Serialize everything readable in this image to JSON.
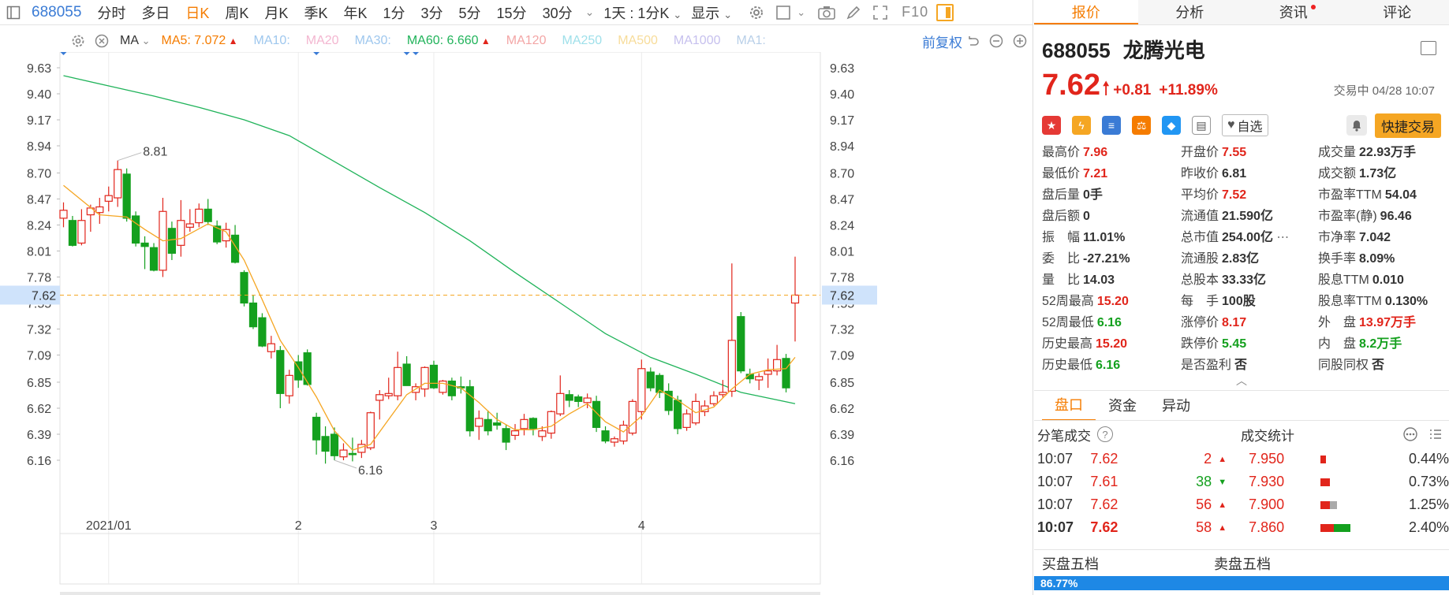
{
  "toolbar": {
    "code": "688055",
    "periods": [
      "分时",
      "多日",
      "日K",
      "周K",
      "月K",
      "季K",
      "年K",
      "1分",
      "3分",
      "5分",
      "15分",
      "30分"
    ],
    "active_period": "日K",
    "interval_label": "1天 : 1分K",
    "display_label": "显示",
    "f10_label": "F10"
  },
  "ma_row": {
    "ma_label": "MA",
    "items": [
      {
        "label": "MA5:",
        "value": "7.072",
        "color": "#f57c00",
        "arrow": "▲"
      },
      {
        "label": "MA10:",
        "value": "",
        "color": "#9ec7ee",
        "arrow": ""
      },
      {
        "label": "MA20",
        "value": "",
        "color": "#f3b6d0",
        "arrow": ""
      },
      {
        "label": "MA30:",
        "value": "",
        "color": "#9ec7ee",
        "arrow": ""
      },
      {
        "label": "MA60:",
        "value": "6.660",
        "color": "#20b35a",
        "arrow": "▲"
      },
      {
        "label": "MA120",
        "value": "",
        "color": "#f3a6a6",
        "arrow": ""
      },
      {
        "label": "MA250",
        "value": "",
        "color": "#9fe0ea",
        "arrow": ""
      },
      {
        "label": "MA500",
        "value": "",
        "color": "#f7dc9a",
        "arrow": ""
      },
      {
        "label": "MA1000",
        "value": "",
        "color": "#c6c0ee",
        "arrow": ""
      },
      {
        "label": "MA1:",
        "value": "",
        "color": "#b8cfe8",
        "arrow": ""
      }
    ],
    "adjust_label": "前复权"
  },
  "chart_data": {
    "type": "candlestick",
    "y_ticks": [
      "9.63",
      "9.40",
      "9.17",
      "8.94",
      "8.70",
      "8.47",
      "8.24",
      "8.01",
      "7.78",
      "7.55",
      "7.32",
      "7.09",
      "6.85",
      "6.62",
      "6.39",
      "6.16"
    ],
    "ylim": [
      6.0,
      9.7
    ],
    "x_labels": [
      {
        "index": 5,
        "label": "2021/01"
      },
      {
        "index": 26,
        "label": "2"
      },
      {
        "index": 41,
        "label": "3"
      },
      {
        "index": 64,
        "label": "4"
      }
    ],
    "current_price_label": "7.62",
    "current_price": 7.62,
    "high_label": {
      "index": 6,
      "value": 8.81,
      "text": "8.81"
    },
    "low_label": {
      "index": 30,
      "value": 6.16,
      "text": "6.16"
    },
    "event_markers": [
      0,
      28,
      38,
      39
    ],
    "candles": [
      {
        "o": 8.3,
        "h": 8.44,
        "l": 8.22,
        "c": 8.37
      },
      {
        "o": 8.28,
        "h": 8.32,
        "l": 8.05,
        "c": 8.06
      },
      {
        "o": 8.08,
        "h": 8.38,
        "l": 8.06,
        "c": 8.28
      },
      {
        "o": 8.33,
        "h": 8.42,
        "l": 8.18,
        "c": 8.39
      },
      {
        "o": 8.35,
        "h": 8.48,
        "l": 8.25,
        "c": 8.4
      },
      {
        "o": 8.45,
        "h": 8.58,
        "l": 8.36,
        "c": 8.5
      },
      {
        "o": 8.48,
        "h": 8.81,
        "l": 8.4,
        "c": 8.73
      },
      {
        "o": 8.69,
        "h": 8.74,
        "l": 8.27,
        "c": 8.3
      },
      {
        "o": 8.32,
        "h": 8.36,
        "l": 8.05,
        "c": 8.08
      },
      {
        "o": 8.08,
        "h": 8.14,
        "l": 7.85,
        "c": 8.05
      },
      {
        "o": 8.04,
        "h": 8.08,
        "l": 7.83,
        "c": 7.84
      },
      {
        "o": 7.84,
        "h": 8.48,
        "l": 7.78,
        "c": 8.36
      },
      {
        "o": 8.21,
        "h": 8.27,
        "l": 7.93,
        "c": 7.99
      },
      {
        "o": 8.06,
        "h": 8.46,
        "l": 7.96,
        "c": 8.28
      },
      {
        "o": 8.22,
        "h": 8.38,
        "l": 8.18,
        "c": 8.25
      },
      {
        "o": 8.26,
        "h": 8.43,
        "l": 8.22,
        "c": 8.38
      },
      {
        "o": 8.38,
        "h": 8.47,
        "l": 8.24,
        "c": 8.27
      },
      {
        "o": 8.23,
        "h": 8.28,
        "l": 8.07,
        "c": 8.09
      },
      {
        "o": 8.1,
        "h": 8.26,
        "l": 8.04,
        "c": 8.2
      },
      {
        "o": 8.15,
        "h": 8.24,
        "l": 7.9,
        "c": 7.91
      },
      {
        "o": 7.82,
        "h": 7.84,
        "l": 7.52,
        "c": 7.55
      },
      {
        "o": 7.55,
        "h": 7.62,
        "l": 7.32,
        "c": 7.34
      },
      {
        "o": 7.42,
        "h": 7.46,
        "l": 7.16,
        "c": 7.17
      },
      {
        "o": 7.12,
        "h": 7.26,
        "l": 7.06,
        "c": 7.19
      },
      {
        "o": 7.13,
        "h": 7.17,
        "l": 6.62,
        "c": 6.75
      },
      {
        "o": 6.73,
        "h": 6.96,
        "l": 6.66,
        "c": 6.91
      },
      {
        "o": 7.03,
        "h": 7.09,
        "l": 6.8,
        "c": 6.87
      },
      {
        "o": 7.11,
        "h": 7.14,
        "l": 6.82,
        "c": 6.83
      },
      {
        "o": 6.54,
        "h": 6.58,
        "l": 6.21,
        "c": 6.34
      },
      {
        "o": 6.37,
        "h": 6.46,
        "l": 6.13,
        "c": 6.24
      },
      {
        "o": 6.39,
        "h": 6.45,
        "l": 6.16,
        "c": 6.2
      },
      {
        "o": 6.19,
        "h": 6.31,
        "l": 6.16,
        "c": 6.25
      },
      {
        "o": 6.22,
        "h": 6.36,
        "l": 6.15,
        "c": 6.21
      },
      {
        "o": 6.23,
        "h": 6.34,
        "l": 6.18,
        "c": 6.3
      },
      {
        "o": 6.27,
        "h": 6.59,
        "l": 6.25,
        "c": 6.58
      },
      {
        "o": 6.69,
        "h": 6.78,
        "l": 6.52,
        "c": 6.74
      },
      {
        "o": 6.73,
        "h": 6.89,
        "l": 6.7,
        "c": 6.75
      },
      {
        "o": 6.73,
        "h": 7.12,
        "l": 6.69,
        "c": 6.98
      },
      {
        "o": 7.01,
        "h": 7.08,
        "l": 6.82,
        "c": 6.82
      },
      {
        "o": 6.76,
        "h": 6.84,
        "l": 6.69,
        "c": 6.81
      },
      {
        "o": 6.79,
        "h": 6.99,
        "l": 6.72,
        "c": 6.98
      },
      {
        "o": 7.0,
        "h": 7.04,
        "l": 6.79,
        "c": 6.8
      },
      {
        "o": 6.76,
        "h": 6.87,
        "l": 6.74,
        "c": 6.86
      },
      {
        "o": 6.86,
        "h": 6.89,
        "l": 6.69,
        "c": 6.73
      },
      {
        "o": 6.81,
        "h": 6.9,
        "l": 6.75,
        "c": 6.8
      },
      {
        "o": 6.81,
        "h": 6.87,
        "l": 6.37,
        "c": 6.42
      },
      {
        "o": 6.46,
        "h": 6.6,
        "l": 6.34,
        "c": 6.53
      },
      {
        "o": 6.52,
        "h": 6.6,
        "l": 6.38,
        "c": 6.42
      },
      {
        "o": 6.49,
        "h": 6.58,
        "l": 6.43,
        "c": 6.47
      },
      {
        "o": 6.44,
        "h": 6.47,
        "l": 6.25,
        "c": 6.32
      },
      {
        "o": 6.38,
        "h": 6.48,
        "l": 6.34,
        "c": 6.42
      },
      {
        "o": 6.44,
        "h": 6.57,
        "l": 6.38,
        "c": 6.52
      },
      {
        "o": 6.53,
        "h": 6.54,
        "l": 6.38,
        "c": 6.44
      },
      {
        "o": 6.37,
        "h": 6.46,
        "l": 6.33,
        "c": 6.42
      },
      {
        "o": 6.4,
        "h": 6.6,
        "l": 6.35,
        "c": 6.59
      },
      {
        "o": 6.57,
        "h": 6.91,
        "l": 6.55,
        "c": 6.75
      },
      {
        "o": 6.74,
        "h": 6.78,
        "l": 6.63,
        "c": 6.69
      },
      {
        "o": 6.72,
        "h": 6.74,
        "l": 6.63,
        "c": 6.68
      },
      {
        "o": 6.67,
        "h": 6.75,
        "l": 6.62,
        "c": 6.71
      },
      {
        "o": 6.68,
        "h": 6.73,
        "l": 6.41,
        "c": 6.45
      },
      {
        "o": 6.42,
        "h": 6.46,
        "l": 6.31,
        "c": 6.33
      },
      {
        "o": 6.32,
        "h": 6.37,
        "l": 6.28,
        "c": 6.35
      },
      {
        "o": 6.33,
        "h": 6.51,
        "l": 6.3,
        "c": 6.47
      },
      {
        "o": 6.4,
        "h": 6.7,
        "l": 6.38,
        "c": 6.68
      },
      {
        "o": 6.59,
        "h": 7.05,
        "l": 6.52,
        "c": 6.97
      },
      {
        "o": 6.94,
        "h": 6.98,
        "l": 6.77,
        "c": 6.8
      },
      {
        "o": 6.91,
        "h": 6.93,
        "l": 6.71,
        "c": 6.76
      },
      {
        "o": 6.77,
        "h": 6.84,
        "l": 6.56,
        "c": 6.6
      },
      {
        "o": 6.69,
        "h": 6.73,
        "l": 6.39,
        "c": 6.44
      },
      {
        "o": 6.45,
        "h": 6.61,
        "l": 6.42,
        "c": 6.57
      },
      {
        "o": 6.49,
        "h": 6.75,
        "l": 6.47,
        "c": 6.68
      },
      {
        "o": 6.59,
        "h": 6.69,
        "l": 6.55,
        "c": 6.64
      },
      {
        "o": 6.66,
        "h": 6.77,
        "l": 6.64,
        "c": 6.73
      },
      {
        "o": 6.74,
        "h": 6.87,
        "l": 6.71,
        "c": 6.76
      },
      {
        "o": 6.77,
        "h": 7.9,
        "l": 6.72,
        "c": 7.22
      },
      {
        "o": 7.43,
        "h": 7.47,
        "l": 6.93,
        "c": 6.95
      },
      {
        "o": 6.92,
        "h": 6.97,
        "l": 6.84,
        "c": 6.88
      },
      {
        "o": 6.87,
        "h": 6.93,
        "l": 6.78,
        "c": 6.9
      },
      {
        "o": 6.92,
        "h": 7.06,
        "l": 6.8,
        "c": 6.95
      },
      {
        "o": 6.95,
        "h": 7.18,
        "l": 6.91,
        "c": 7.05
      },
      {
        "o": 7.06,
        "h": 7.1,
        "l": 6.76,
        "c": 6.8
      },
      {
        "o": 7.55,
        "h": 7.96,
        "l": 7.21,
        "c": 7.62
      }
    ],
    "ma5": [
      [
        0,
        8.59
      ],
      [
        4,
        8.33
      ],
      [
        7,
        8.31
      ],
      [
        9,
        8.2
      ],
      [
        11,
        8.1
      ],
      [
        13,
        8.12
      ],
      [
        16,
        8.25
      ],
      [
        18,
        8.18
      ],
      [
        20,
        7.93
      ],
      [
        22,
        7.58
      ],
      [
        24,
        7.22
      ],
      [
        26,
        6.98
      ],
      [
        28,
        6.72
      ],
      [
        30,
        6.42
      ],
      [
        32,
        6.25
      ],
      [
        34,
        6.3
      ],
      [
        36,
        6.52
      ],
      [
        38,
        6.74
      ],
      [
        40,
        6.84
      ],
      [
        42,
        6.84
      ],
      [
        44,
        6.8
      ],
      [
        46,
        6.67
      ],
      [
        48,
        6.52
      ],
      [
        50,
        6.43
      ],
      [
        52,
        6.43
      ],
      [
        54,
        6.46
      ],
      [
        56,
        6.57
      ],
      [
        58,
        6.66
      ],
      [
        60,
        6.5
      ],
      [
        62,
        6.41
      ],
      [
        64,
        6.55
      ],
      [
        66,
        6.78
      ],
      [
        68,
        6.69
      ],
      [
        70,
        6.58
      ],
      [
        72,
        6.63
      ],
      [
        74,
        6.79
      ],
      [
        76,
        6.92
      ],
      [
        78,
        6.96
      ],
      [
        80,
        6.97
      ],
      [
        81,
        7.07
      ]
    ],
    "ma60": [
      [
        0,
        9.56
      ],
      [
        5,
        9.47
      ],
      [
        10,
        9.38
      ],
      [
        15,
        9.28
      ],
      [
        20,
        9.17
      ],
      [
        25,
        9.03
      ],
      [
        30,
        8.8
      ],
      [
        35,
        8.57
      ],
      [
        40,
        8.35
      ],
      [
        45,
        8.1
      ],
      [
        50,
        7.82
      ],
      [
        55,
        7.55
      ],
      [
        60,
        7.28
      ],
      [
        65,
        7.07
      ],
      [
        70,
        6.92
      ],
      [
        75,
        6.76
      ],
      [
        81,
        6.66
      ]
    ]
  },
  "panel": {
    "tabs": [
      "报价",
      "分析",
      "资讯",
      "评论"
    ],
    "active_tab": "报价",
    "code": "688055",
    "name": "龙腾光电",
    "price": "7.62",
    "change": "+0.81",
    "change_pct": "+11.89%",
    "status": "交易中 04/28 10:07",
    "watch_label": "自选",
    "quick_trade_label": "快捷交易",
    "quotes": [
      {
        "label": "最高价",
        "value": "7.96",
        "cls": "red"
      },
      {
        "label": "开盘价",
        "value": "7.55",
        "cls": "red"
      },
      {
        "label": "成交量",
        "value": "22.93万手",
        "cls": ""
      },
      {
        "label": "最低价",
        "value": "7.21",
        "cls": "red"
      },
      {
        "label": "昨收价",
        "value": "6.81",
        "cls": ""
      },
      {
        "label": "成交额",
        "value": "1.73亿",
        "cls": ""
      },
      {
        "label": "盘后量",
        "value": "0手",
        "cls": ""
      },
      {
        "label": "平均价",
        "value": "7.52",
        "cls": "red"
      },
      {
        "label": "市盈率TTM",
        "value": "54.04",
        "cls": ""
      },
      {
        "label": "盘后额",
        "value": "0",
        "cls": ""
      },
      {
        "label": "流通值",
        "value": "21.590亿",
        "cls": ""
      },
      {
        "label": "市盈率(静)",
        "value": "96.46",
        "cls": ""
      },
      {
        "label": "振　幅",
        "value": "11.01%",
        "cls": ""
      },
      {
        "label": "总市值",
        "value": "254.00亿",
        "cls": ""
      },
      {
        "label": "市净率",
        "value": "7.042",
        "cls": ""
      },
      {
        "label": "委　比",
        "value": "-27.21%",
        "cls": ""
      },
      {
        "label": "流通股",
        "value": "2.83亿",
        "cls": ""
      },
      {
        "label": "换手率",
        "value": "8.09%",
        "cls": ""
      },
      {
        "label": "量　比",
        "value": "14.03",
        "cls": ""
      },
      {
        "label": "总股本",
        "value": "33.33亿",
        "cls": ""
      },
      {
        "label": "股息TTM",
        "value": "0.010",
        "cls": ""
      },
      {
        "label": "52周最高",
        "value": "15.20",
        "cls": "red"
      },
      {
        "label": "每　手",
        "value": "100股",
        "cls": ""
      },
      {
        "label": "股息率TTM",
        "value": "0.130%",
        "cls": ""
      },
      {
        "label": "52周最低",
        "value": "6.16",
        "cls": "green"
      },
      {
        "label": "涨停价",
        "value": "8.17",
        "cls": "red"
      },
      {
        "label": "外　盘",
        "value": "13.97万手",
        "cls": "red"
      },
      {
        "label": "历史最高",
        "value": "15.20",
        "cls": "red"
      },
      {
        "label": "跌停价",
        "value": "5.45",
        "cls": "green"
      },
      {
        "label": "内　盘",
        "value": "8.2万手",
        "cls": "green"
      },
      {
        "label": "历史最低",
        "value": "6.16",
        "cls": "green"
      },
      {
        "label": "是否盈利",
        "value": "否",
        "cls": ""
      },
      {
        "label": "同股同权",
        "value": "否",
        "cls": ""
      }
    ],
    "sub_tabs": [
      "盘口",
      "资金",
      "异动"
    ],
    "active_sub_tab": "盘口",
    "tick_title": "分笔成交",
    "stats_title": "成交统计",
    "ticks": [
      {
        "time": "10:07",
        "price": "7.62",
        "vol": "2",
        "dir": "up",
        "stat_price": "7.950",
        "pct": "0.44%",
        "bar_red": 0.08,
        "bar_green": 0,
        "bar_gray": 0
      },
      {
        "time": "10:07",
        "price": "7.61",
        "vol": "38",
        "dir": "down",
        "stat_price": "7.930",
        "pct": "0.73%",
        "bar_red": 0.13,
        "bar_green": 0,
        "bar_gray": 0
      },
      {
        "time": "10:07",
        "price": "7.62",
        "vol": "56",
        "dir": "up",
        "stat_price": "7.900",
        "pct": "1.25%",
        "bar_red": 0.13,
        "bar_green": 0,
        "bar_gray": 0.09
      },
      {
        "time": "10:07",
        "price": "7.62",
        "vol": "58",
        "dir": "up",
        "stat_price": "7.860",
        "pct": "2.40%",
        "bar_red": 0.18,
        "bar_green": 0.22,
        "bar_gray": 0
      }
    ],
    "buy_book_label": "买盘五档",
    "sell_book_label": "卖盘五档",
    "buy_ratio": "86.77%"
  }
}
